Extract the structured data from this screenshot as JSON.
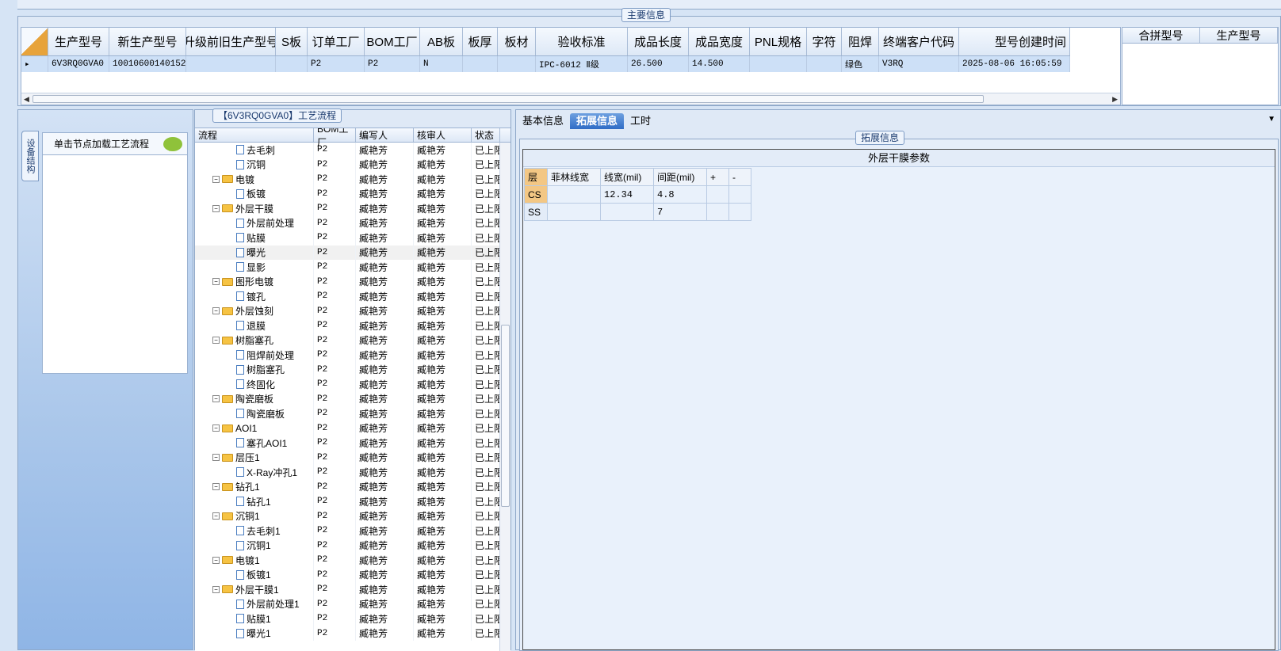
{
  "main_info": {
    "legend": "主要信息",
    "columns": [
      "生产型号",
      "新生产型号",
      "升级前旧生产型号",
      "S板",
      "订单工厂",
      "BOM工厂",
      "AB板",
      "板厚",
      "板材",
      "验收标准",
      "成品长度",
      "成品宽度",
      "PNL规格",
      "字符",
      "阻焊",
      "终端客户代码",
      "型号创建时间"
    ],
    "row": [
      "6V3RQ0GVA0",
      "10010600140152",
      "",
      "",
      "P2",
      "P2",
      "N",
      "",
      "",
      "IPC-6012 Ⅱ级",
      "26.500",
      "14.500",
      "",
      "",
      "绿色",
      "V3RQ",
      "2025-08-06 16:05:59"
    ],
    "merge_columns": [
      "合拼型号",
      "生产型号"
    ]
  },
  "left_panel": {
    "vertical_tab": "设备结构",
    "hint": "单击节点加载工艺流程"
  },
  "flow": {
    "legend": "【6V3RQ0GVA0】工艺流程",
    "columns": [
      "流程",
      "BOM工厂",
      "编写人",
      "核审人",
      "状态"
    ],
    "rows": [
      {
        "name": "去毛刺",
        "type": "leaf",
        "bom": "P2",
        "writer": "臧艳芳",
        "reviewer": "臧艳芳",
        "status": "已上限"
      },
      {
        "name": "沉铜",
        "type": "leaf",
        "bom": "P2",
        "writer": "臧艳芳",
        "reviewer": "臧艳芳",
        "status": "已上限"
      },
      {
        "name": "电镀",
        "type": "folder",
        "bom": "P2",
        "writer": "臧艳芳",
        "reviewer": "臧艳芳",
        "status": "已上限"
      },
      {
        "name": "板镀",
        "type": "leaf",
        "bom": "P2",
        "writer": "臧艳芳",
        "reviewer": "臧艳芳",
        "status": "已上限"
      },
      {
        "name": "外层干膜",
        "type": "folder",
        "bom": "P2",
        "writer": "臧艳芳",
        "reviewer": "臧艳芳",
        "status": "已上限"
      },
      {
        "name": "外层前处理",
        "type": "leaf",
        "bom": "P2",
        "writer": "臧艳芳",
        "reviewer": "臧艳芳",
        "status": "已上限"
      },
      {
        "name": "贴膜",
        "type": "leaf",
        "bom": "P2",
        "writer": "臧艳芳",
        "reviewer": "臧艳芳",
        "status": "已上限"
      },
      {
        "name": "曝光",
        "type": "leaf",
        "bom": "P2",
        "writer": "臧艳芳",
        "reviewer": "臧艳芳",
        "status": "已上限",
        "selected": true
      },
      {
        "name": "显影",
        "type": "leaf",
        "bom": "P2",
        "writer": "臧艳芳",
        "reviewer": "臧艳芳",
        "status": "已上限"
      },
      {
        "name": "图形电镀",
        "type": "folder",
        "bom": "P2",
        "writer": "臧艳芳",
        "reviewer": "臧艳芳",
        "status": "已上限"
      },
      {
        "name": "镀孔",
        "type": "leaf",
        "bom": "P2",
        "writer": "臧艳芳",
        "reviewer": "臧艳芳",
        "status": "已上限"
      },
      {
        "name": "外层蚀刻",
        "type": "folder",
        "bom": "P2",
        "writer": "臧艳芳",
        "reviewer": "臧艳芳",
        "status": "已上限"
      },
      {
        "name": "退膜",
        "type": "leaf",
        "bom": "P2",
        "writer": "臧艳芳",
        "reviewer": "臧艳芳",
        "status": "已上限"
      },
      {
        "name": "树脂塞孔",
        "type": "folder",
        "bom": "P2",
        "writer": "臧艳芳",
        "reviewer": "臧艳芳",
        "status": "已上限"
      },
      {
        "name": "阻焊前处理",
        "type": "leaf",
        "bom": "P2",
        "writer": "臧艳芳",
        "reviewer": "臧艳芳",
        "status": "已上限"
      },
      {
        "name": "树脂塞孔",
        "type": "leaf",
        "bom": "P2",
        "writer": "臧艳芳",
        "reviewer": "臧艳芳",
        "status": "已上限"
      },
      {
        "name": "终固化",
        "type": "leaf",
        "bom": "P2",
        "writer": "臧艳芳",
        "reviewer": "臧艳芳",
        "status": "已上限"
      },
      {
        "name": "陶瓷磨板",
        "type": "folder",
        "bom": "P2",
        "writer": "臧艳芳",
        "reviewer": "臧艳芳",
        "status": "已上限"
      },
      {
        "name": "陶瓷磨板",
        "type": "leaf",
        "bom": "P2",
        "writer": "臧艳芳",
        "reviewer": "臧艳芳",
        "status": "已上限"
      },
      {
        "name": "AOI1",
        "type": "folder",
        "bom": "P2",
        "writer": "臧艳芳",
        "reviewer": "臧艳芳",
        "status": "已上限"
      },
      {
        "name": "塞孔AOI1",
        "type": "leaf",
        "bom": "P2",
        "writer": "臧艳芳",
        "reviewer": "臧艳芳",
        "status": "已上限"
      },
      {
        "name": "层压1",
        "type": "folder",
        "bom": "P2",
        "writer": "臧艳芳",
        "reviewer": "臧艳芳",
        "status": "已上限"
      },
      {
        "name": "X-Ray冲孔1",
        "type": "leaf",
        "bom": "P2",
        "writer": "臧艳芳",
        "reviewer": "臧艳芳",
        "status": "已上限"
      },
      {
        "name": "钻孔1",
        "type": "folder",
        "bom": "P2",
        "writer": "臧艳芳",
        "reviewer": "臧艳芳",
        "status": "已上限"
      },
      {
        "name": "钻孔1",
        "type": "leaf",
        "bom": "P2",
        "writer": "臧艳芳",
        "reviewer": "臧艳芳",
        "status": "已上限"
      },
      {
        "name": "沉铜1",
        "type": "folder",
        "bom": "P2",
        "writer": "臧艳芳",
        "reviewer": "臧艳芳",
        "status": "已上限"
      },
      {
        "name": "去毛刺1",
        "type": "leaf",
        "bom": "P2",
        "writer": "臧艳芳",
        "reviewer": "臧艳芳",
        "status": "已上限"
      },
      {
        "name": "沉铜1",
        "type": "leaf",
        "bom": "P2",
        "writer": "臧艳芳",
        "reviewer": "臧艳芳",
        "status": "已上限"
      },
      {
        "name": "电镀1",
        "type": "folder",
        "bom": "P2",
        "writer": "臧艳芳",
        "reviewer": "臧艳芳",
        "status": "已上限"
      },
      {
        "name": "板镀1",
        "type": "leaf",
        "bom": "P2",
        "writer": "臧艳芳",
        "reviewer": "臧艳芳",
        "status": "已上限"
      },
      {
        "name": "外层干膜1",
        "type": "folder",
        "bom": "P2",
        "writer": "臧艳芳",
        "reviewer": "臧艳芳",
        "status": "已上限"
      },
      {
        "name": "外层前处理1",
        "type": "leaf",
        "bom": "P2",
        "writer": "臧艳芳",
        "reviewer": "臧艳芳",
        "status": "已上限"
      },
      {
        "name": "贴膜1",
        "type": "leaf",
        "bom": "P2",
        "writer": "臧艳芳",
        "reviewer": "臧艳芳",
        "status": "已上限"
      },
      {
        "name": "曝光1",
        "type": "leaf",
        "bom": "P2",
        "writer": "臧艳芳",
        "reviewer": "臧艳芳",
        "status": "已上限"
      }
    ]
  },
  "detail": {
    "tabs": [
      {
        "label": "基本信息",
        "active": false
      },
      {
        "label": "拓展信息",
        "active": true
      },
      {
        "label": "工时",
        "active": false
      }
    ],
    "legend": "拓展信息",
    "section_title": "外层干膜参数",
    "table_columns": [
      "层",
      "菲林线宽",
      "线宽(mil)",
      "间距(mil)",
      "+",
      "-"
    ],
    "table_rows": [
      [
        "CS",
        "",
        "12.34",
        "4.8",
        "",
        ""
      ],
      [
        "SS",
        "",
        "",
        "7",
        "",
        ""
      ]
    ]
  }
}
